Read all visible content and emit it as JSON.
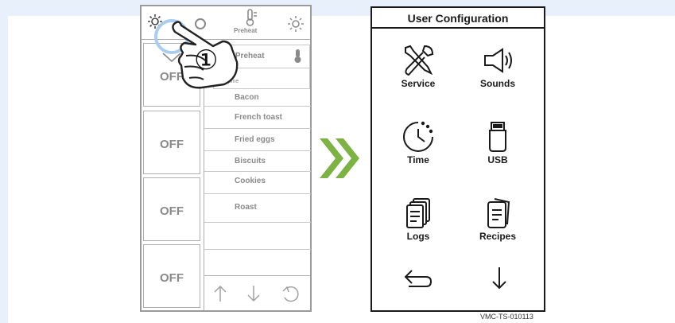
{
  "left_screen": {
    "topbar": {
      "settings_icon": "gear-icon",
      "preheat_label": "Preheat",
      "light_icon": "sun-icon"
    },
    "zones": [
      {
        "label": "OFF"
      },
      {
        "label": "OFF"
      },
      {
        "label": "OFF"
      },
      {
        "label": "OFF"
      }
    ],
    "dropdown": {
      "item_label": "o Preheat",
      "sub_label": "pine"
    },
    "menu_items": [
      "Bacon",
      "French toast",
      "Fried eggs",
      "Biscuits",
      "Cookies",
      "Roast"
    ],
    "step_marker": "①",
    "bottom_nav": [
      "up-arrow-icon",
      "down-arrow-icon",
      "undo-icon"
    ]
  },
  "right_screen": {
    "title": "User Configuration",
    "items": [
      {
        "label": "Service",
        "icon": "wrench-screwdriver-icon"
      },
      {
        "label": "Sounds",
        "icon": "speaker-icon"
      },
      {
        "label": "Time",
        "icon": "clock-icon"
      },
      {
        "label": "USB",
        "icon": "usb-icon"
      },
      {
        "label": "Logs",
        "icon": "logs-icon"
      },
      {
        "label": "Recipes",
        "icon": "recipes-icon"
      }
    ],
    "bottom_nav": [
      "back-icon",
      "down-arrow-icon"
    ]
  },
  "colors": {
    "accent": "#7cb342",
    "border_dark": "#1a1a1a",
    "muted_text": "#8a8a8a",
    "highlight_ring": "#a9cdef",
    "page_bg": "#e8f1fb"
  },
  "footer_code": "VMC-TS-010113"
}
